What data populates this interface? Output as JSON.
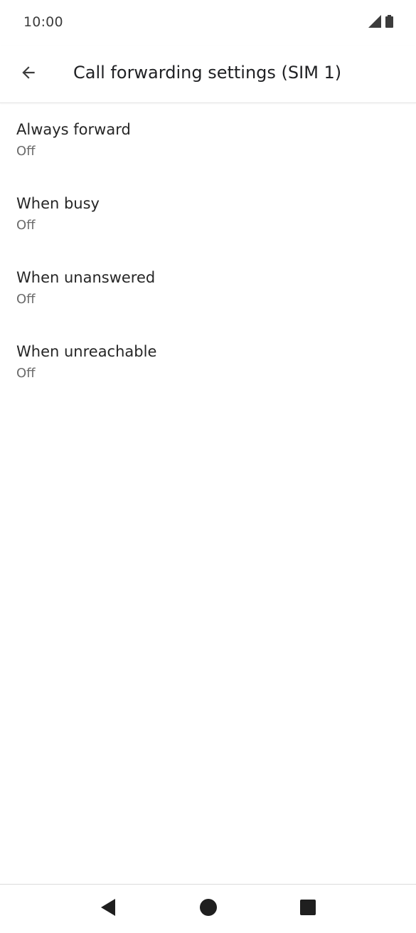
{
  "status_bar": {
    "time": "10:00",
    "icons": [
      "cellular-signal-icon",
      "battery-icon"
    ]
  },
  "app_bar": {
    "back_icon": "arrow-back-icon",
    "title": "Call forwarding settings (SIM 1)"
  },
  "settings": {
    "items": [
      {
        "title": "Always forward",
        "summary": "Off"
      },
      {
        "title": "When busy",
        "summary": "Off"
      },
      {
        "title": "When unanswered",
        "summary": "Off"
      },
      {
        "title": "When unreachable",
        "summary": "Off"
      }
    ]
  },
  "nav_bar": {
    "icons": [
      "back-triangle-icon",
      "home-circle-icon",
      "recents-square-icon"
    ]
  },
  "colors": {
    "icon": "#1f1f1f",
    "text_primary": "#262626",
    "text_secondary": "#6b6b6b"
  }
}
